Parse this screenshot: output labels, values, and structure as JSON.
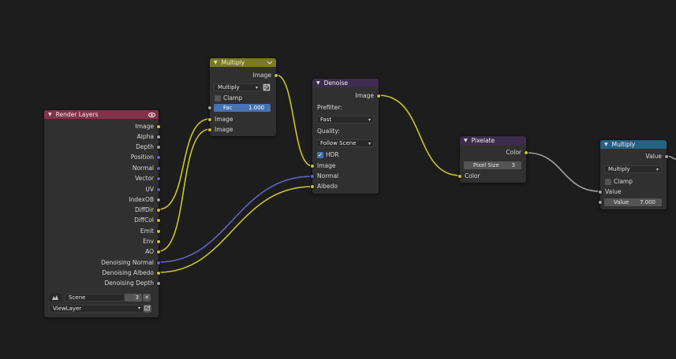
{
  "colors": {
    "render_layers_header": "#83314a",
    "multiply_header": "#7a7a1f",
    "denoise_header": "#3d2c4d",
    "pixelate_header": "#3d2c4d",
    "multiply_math_header": "#246283",
    "yellow_socket": "#c7c729",
    "gray_socket": "#a1a1a1",
    "purple_socket": "#6363c7",
    "accent_blue": "#4772b3"
  },
  "render_layers": {
    "title": "Render Layers",
    "outputs": [
      "Image",
      "Alpha",
      "Depth",
      "Position",
      "Normal",
      "Vector",
      "UV",
      "IndexOB",
      "DiffDir",
      "DiffCol",
      "Emit",
      "Env",
      "AO",
      "Denoising Normal",
      "Denoising Albedo",
      "Denoising Depth"
    ],
    "scene_value": "Scene",
    "scene_users": "3",
    "close_glyph": "✕",
    "view_layer": "ViewLayer"
  },
  "multiply_mix": {
    "title": "Multiply",
    "output": "Image",
    "blend_mode": "Multiply",
    "clamp_label": "Clamp",
    "fac_label": "Fac",
    "fac_value": "1.000",
    "input_a": "Image",
    "input_b": "Image"
  },
  "denoise": {
    "title": "Denoise",
    "output": "Image",
    "prefilter_label": "Prefilter:",
    "prefilter_value": "Fast",
    "quality_label": "Quality:",
    "quality_value": "Follow Scene",
    "hdr_label": "HDR",
    "inputs": [
      "Image",
      "Normal",
      "Albedo"
    ]
  },
  "pixelate": {
    "title": "Pixelate",
    "output": "Color",
    "pixel_size_label": "Pixel Size",
    "pixel_size_value": "3",
    "input": "Color"
  },
  "multiply_math": {
    "title": "Multiply",
    "output": "Value",
    "operation": "Multiply",
    "clamp_label": "Clamp",
    "input_label": "Value",
    "value_label": "Value",
    "value_value": "7.000"
  }
}
